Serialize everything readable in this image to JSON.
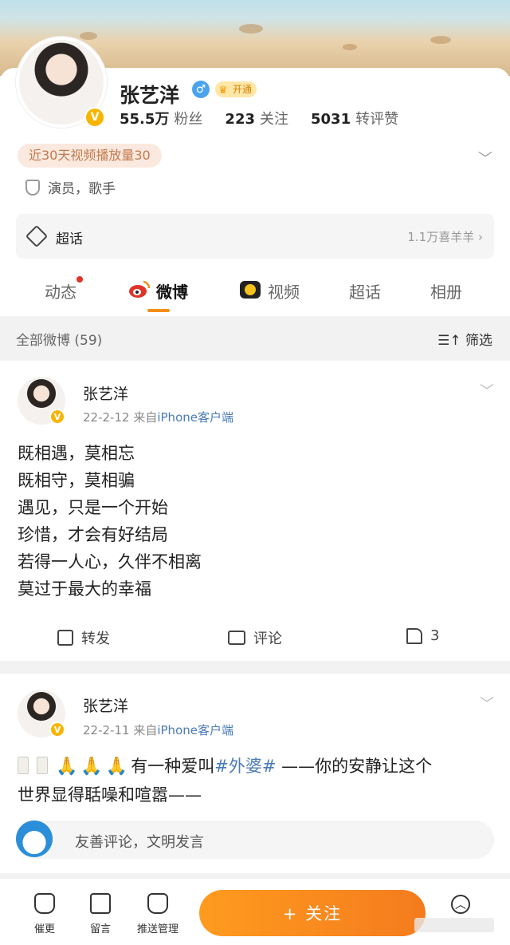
{
  "profile": {
    "name": "张艺洋",
    "vip_label": "开通",
    "followers_value": "55.5万",
    "followers_label": "粉丝",
    "following_value": "223",
    "following_label": "关注",
    "likes_value": "5031",
    "likes_label": "转评赞",
    "play_badge": "近30天视频播放量30",
    "role": "演员，歌手"
  },
  "super_topic": {
    "label": "超话",
    "right_text": "1.1万喜羊羊 ›"
  },
  "tabs": [
    {
      "label": "动态"
    },
    {
      "label": "微博"
    },
    {
      "label": "视频"
    },
    {
      "label": "超话"
    },
    {
      "label": "相册"
    }
  ],
  "filterbar": {
    "all_label": "全部微博 (59)",
    "filter_label": "筛选"
  },
  "posts": [
    {
      "author": "张艺洋",
      "date": "22-2-12",
      "from": "来自",
      "source": "iPhone客户端",
      "lines": [
        "既相遇，莫相忘",
        "既相守，莫相骗",
        "遇见，只是一个开始",
        "珍惜，才会有好结局",
        "若得一人心，久伴不相离",
        "莫过于最大的幸福"
      ],
      "repost_label": "转发",
      "comment_label": "评论",
      "like_count": "3"
    },
    {
      "author": "张艺洋",
      "date": "22-2-11",
      "from": "来自",
      "source": "iPhone客户端",
      "text_before": "有一种爱叫",
      "hashtag": "#外婆#",
      "text_after": " ——你的安静让这个",
      "line2": "世界显得聒噪和喧嚣——"
    }
  ],
  "comment_placeholder": "友善评论，文明发言",
  "bottom": {
    "nav1": "催更",
    "nav2": "留言",
    "nav3": "推送管理",
    "follow_label": "+ 关注"
  }
}
